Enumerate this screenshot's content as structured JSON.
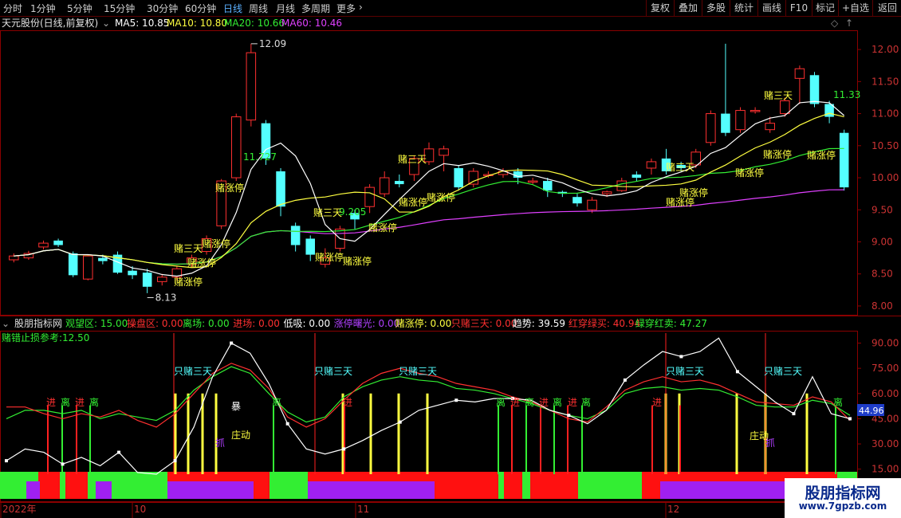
{
  "toolbar": {
    "tabs": [
      "分时",
      "1分钟",
      "5分钟",
      "15分钟",
      "30分钟",
      "60分钟",
      "日线",
      "周线",
      "月线",
      "多周期",
      "更多"
    ],
    "active_tab": "日线",
    "right_buttons": [
      "复权",
      "叠加",
      "多股",
      "统计",
      "画线",
      "F10",
      "标记",
      "+自选",
      "返回"
    ]
  },
  "main_info": {
    "stock": "天元股份(日线,前复权)",
    "ma5": "MA5: 10.85",
    "ma10": "MA10: 10.80",
    "ma20": "MA20: 10.66",
    "ma60": "MA60: 10.46"
  },
  "indicator_info": {
    "name": "股朋指标网",
    "items": [
      {
        "text": "观望区: 15.00",
        "color": "#33ee33"
      },
      {
        "text": "操盘区: 0.00",
        "color": "#ff3030"
      },
      {
        "text": "离场: 0.00",
        "color": "#33ee33"
      },
      {
        "text": "进场: 0.00",
        "color": "#ff3030"
      },
      {
        "text": "低吸: 0.00",
        "color": "#ffffff"
      },
      {
        "text": "涨停曙光: 0.00",
        "color": "#b040ff"
      },
      {
        "text": "赌涨停: 0.00",
        "color": "#ffff40"
      },
      {
        "text": "只赌三天: 0.00",
        "color": "#ff3030"
      },
      {
        "text": "趋势: 39.59",
        "color": "#ffffff"
      },
      {
        "text": "红穿绿买: 40.94",
        "color": "#ff3030"
      },
      {
        "text": "绿穿红卖: 47.27",
        "color": "#33ee33"
      }
    ],
    "stoploss": "赌错止损参考:12.50"
  },
  "chart_data": [
    {
      "type": "candlestick",
      "title": "天元股份(日线,前复权)",
      "ylim": [
        7.9,
        12.25
      ],
      "yticks": [
        "12.00",
        "11.50",
        "11.00",
        "10.50",
        "10.00",
        "9.50",
        "9.00",
        "8.50",
        "8.00"
      ],
      "high_label": "12.09",
      "low_label": "8.13",
      "price_labels": [
        "11.727",
        "9.205",
        "11.33"
      ],
      "candles": [
        [
          8.72,
          8.78,
          8.68,
          8.82
        ],
        [
          8.75,
          8.82,
          8.72,
          8.86
        ],
        [
          8.92,
          8.98,
          8.88,
          9.02
        ],
        [
          9.02,
          8.95,
          8.92,
          9.05
        ],
        [
          8.82,
          8.48,
          8.45,
          8.85
        ],
        [
          8.42,
          8.78,
          8.4,
          8.8
        ],
        [
          8.75,
          8.7,
          8.65,
          8.8
        ],
        [
          8.8,
          8.52,
          8.5,
          8.85
        ],
        [
          8.55,
          8.48,
          8.42,
          8.62
        ],
        [
          8.52,
          8.3,
          8.2,
          8.58
        ],
        [
          8.38,
          8.45,
          8.32,
          8.5
        ],
        [
          8.45,
          8.58,
          8.4,
          8.62
        ],
        [
          8.65,
          8.75,
          8.6,
          8.8
        ],
        [
          8.85,
          9.05,
          8.8,
          9.1
        ],
        [
          9.25,
          9.95,
          9.2,
          9.98
        ],
        [
          10.0,
          10.95,
          9.95,
          11.0
        ],
        [
          10.9,
          11.95,
          10.8,
          12.09
        ],
        [
          10.85,
          10.3,
          10.2,
          10.9
        ],
        [
          10.1,
          9.55,
          9.4,
          10.15
        ],
        [
          9.25,
          8.95,
          8.85,
          9.3
        ],
        [
          9.05,
          8.8,
          8.7,
          9.1
        ],
        [
          8.65,
          8.75,
          8.6,
          8.9
        ],
        [
          8.9,
          9.2,
          8.85,
          9.25
        ],
        [
          9.45,
          9.35,
          9.2,
          9.5
        ],
        [
          9.55,
          9.85,
          9.45,
          9.9
        ],
        [
          9.75,
          10.0,
          9.7,
          10.1
        ],
        [
          9.95,
          9.9,
          9.85,
          10.05
        ],
        [
          10.05,
          10.3,
          9.95,
          10.35
        ],
        [
          10.25,
          10.45,
          10.2,
          10.55
        ],
        [
          10.35,
          10.45,
          10.1,
          10.5
        ],
        [
          10.15,
          9.85,
          9.8,
          10.2
        ],
        [
          9.9,
          10.1,
          9.85,
          10.15
        ],
        [
          10.05,
          10.05,
          10.0,
          10.1
        ],
        [
          10.05,
          10.1,
          10.0,
          10.15
        ],
        [
          10.1,
          10.0,
          9.9,
          10.15
        ],
        [
          9.95,
          9.95,
          9.9,
          10.0
        ],
        [
          9.95,
          9.8,
          9.7,
          10.0
        ],
        [
          9.78,
          9.75,
          9.7,
          9.8
        ],
        [
          9.7,
          9.6,
          9.55,
          9.75
        ],
        [
          9.5,
          9.65,
          9.45,
          9.7
        ],
        [
          9.75,
          9.78,
          9.7,
          9.8
        ],
        [
          9.8,
          9.95,
          9.78,
          10.0
        ],
        [
          10.05,
          10.0,
          9.95,
          10.1
        ],
        [
          10.15,
          10.25,
          10.05,
          10.3
        ],
        [
          10.3,
          10.1,
          10.05,
          10.45
        ],
        [
          10.2,
          10.15,
          10.1,
          10.25
        ],
        [
          10.2,
          10.4,
          10.15,
          10.45
        ],
        [
          10.55,
          11.0,
          10.5,
          11.05
        ],
        [
          11.0,
          10.7,
          10.65,
          12.09
        ],
        [
          10.75,
          11.05,
          10.7,
          11.1
        ],
        [
          11.05,
          11.05,
          11.0,
          11.1
        ],
        [
          10.75,
          10.85,
          10.7,
          10.95
        ],
        [
          11.0,
          11.2,
          10.95,
          11.25
        ],
        [
          11.55,
          11.7,
          11.15,
          11.75
        ],
        [
          11.6,
          11.15,
          11.1,
          11.65
        ],
        [
          11.15,
          10.95,
          10.85,
          11.2
        ],
        [
          10.7,
          9.85,
          9.8,
          10.75
        ]
      ]
    },
    {
      "type": "line",
      "title": "股朋指标网",
      "ylim": [
        12,
        95
      ],
      "yticks": [
        "90.00",
        "75.00",
        "60.00",
        "45.00",
        "30.00",
        "15.00"
      ],
      "current_label": "44.96",
      "signals": [
        "进",
        "离",
        "进",
        "离",
        "暴",
        "庄动",
        "只赌三天",
        "抓",
        "离",
        "进",
        "离",
        "进",
        "离",
        "庄动",
        "抓"
      ],
      "series": [
        {
          "name": "趋势",
          "color": "#ffffff",
          "values": [
            20,
            27,
            25,
            18,
            22,
            17,
            25,
            13,
            12,
            20,
            40,
            70,
            90,
            84,
            66,
            42,
            27,
            24,
            27,
            32,
            38,
            43,
            50,
            53,
            56,
            55,
            57,
            57,
            56,
            50,
            47,
            42,
            50,
            68,
            77,
            85,
            82,
            85,
            93,
            73,
            64,
            55,
            48,
            70,
            48,
            45
          ]
        },
        {
          "name": "红穿绿买",
          "color": "#ff3030",
          "values": [
            52,
            52,
            48,
            45,
            48,
            46,
            50,
            44,
            40,
            48,
            60,
            72,
            78,
            74,
            63,
            46,
            40,
            45,
            56,
            66,
            72,
            75,
            72,
            70,
            66,
            64,
            62,
            58,
            55,
            50,
            45,
            43,
            52,
            62,
            67,
            70,
            67,
            68,
            65,
            60,
            55,
            54,
            53,
            58,
            55,
            44
          ]
        },
        {
          "name": "绿穿红卖",
          "color": "#33ee33",
          "values": [
            45,
            50,
            50,
            48,
            50,
            45,
            48,
            46,
            44,
            50,
            62,
            70,
            76,
            72,
            60,
            49,
            43,
            46,
            58,
            64,
            68,
            70,
            68,
            67,
            63,
            62,
            60,
            57,
            54,
            50,
            47,
            45,
            50,
            60,
            63,
            64,
            62,
            63,
            62,
            58,
            53,
            52,
            52,
            56,
            54,
            47
          ]
        }
      ]
    }
  ],
  "axis_labels": {
    "months": [
      "2022年",
      "10",
      "11",
      "12"
    ]
  },
  "annotations": {
    "du_zhang_ting": "赌涨停",
    "du_san_tian": "赌三天",
    "zhi_du_san_tian": "只赌三天",
    "jin": "进",
    "li": "离",
    "bao": "暴",
    "zhuang_dong": "庄动",
    "zhua": "抓"
  },
  "colors": {
    "up": "#ff3030",
    "down": "#54ffff",
    "ma5": "#ffffff",
    "ma10": "#ffff40",
    "ma20": "#33ee33",
    "ma60": "#e040ff",
    "axis": "#8b0000"
  },
  "watermark": {
    "line1": "股朋指标网",
    "line2": "www.7gpzb.com"
  }
}
